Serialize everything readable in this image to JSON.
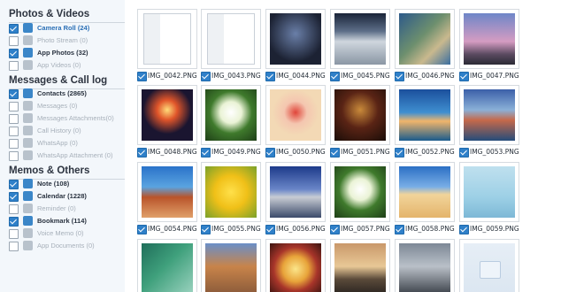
{
  "sidebar": {
    "sections": [
      {
        "title": "Photos & Videos",
        "items": [
          {
            "label": "Camera Roll (24)",
            "checked": true,
            "style": "sel",
            "icon": "camera-icon"
          },
          {
            "label": "Photo Stream (0)",
            "checked": false,
            "style": "off",
            "icon": "cloud-icon"
          },
          {
            "label": "App Photos (32)",
            "checked": true,
            "style": "bold",
            "icon": "app-photos-icon"
          },
          {
            "label": "App Videos (0)",
            "checked": false,
            "style": "off",
            "icon": "video-icon"
          }
        ]
      },
      {
        "title": "Messages & Call log",
        "items": [
          {
            "label": "Contacts (2865)",
            "checked": true,
            "style": "bold",
            "icon": "contacts-icon"
          },
          {
            "label": "Messages (0)",
            "checked": false,
            "style": "off",
            "icon": "message-icon"
          },
          {
            "label": "Messages Attachments(0)",
            "checked": false,
            "style": "off",
            "icon": "attachment-icon"
          },
          {
            "label": "Call History (0)",
            "checked": false,
            "style": "off",
            "icon": "phone-icon"
          },
          {
            "label": "WhatsApp (0)",
            "checked": false,
            "style": "off",
            "icon": "whatsapp-icon"
          },
          {
            "label": "WhatsApp Attachment (0)",
            "checked": false,
            "style": "off",
            "icon": "whatsapp-attachment-icon"
          }
        ]
      },
      {
        "title": "Memos & Others",
        "items": [
          {
            "label": "Note (108)",
            "checked": true,
            "style": "bold",
            "icon": "note-icon"
          },
          {
            "label": "Calendar (1228)",
            "checked": true,
            "style": "bold",
            "icon": "calendar-icon"
          },
          {
            "label": "Reminder (0)",
            "checked": false,
            "style": "off",
            "icon": "reminder-icon"
          },
          {
            "label": "Bookmark (114)",
            "checked": true,
            "style": "bold",
            "icon": "bookmark-icon"
          },
          {
            "label": "Voice Memo (0)",
            "checked": false,
            "style": "off",
            "icon": "microphone-icon"
          },
          {
            "label": "App Documents (0)",
            "checked": false,
            "style": "off",
            "icon": "document-icon"
          }
        ]
      }
    ]
  },
  "photos": [
    {
      "name": "IMG_0042.PNG",
      "checked": true,
      "thumb": "settings-screenshot"
    },
    {
      "name": "IMG_0043.PNG",
      "checked": true,
      "thumb": "settings-screenshot"
    },
    {
      "name": "IMG_0044.PNG",
      "checked": true,
      "thumb": "ipad-homescreen"
    },
    {
      "name": "IMG_0045.PNG",
      "checked": true,
      "thumb": "mountain-clouds"
    },
    {
      "name": "IMG_0046.PNG",
      "checked": true,
      "thumb": "coastline"
    },
    {
      "name": "IMG_0047.PNG",
      "checked": true,
      "thumb": "stonehenge"
    },
    {
      "name": "IMG_0048.PNG",
      "checked": true,
      "thumb": "fireworks"
    },
    {
      "name": "IMG_0049.PNG",
      "checked": true,
      "thumb": "white-rose"
    },
    {
      "name": "IMG_0050.PNG",
      "checked": true,
      "thumb": "cartoon-girl"
    },
    {
      "name": "IMG_0051.PNG",
      "checked": true,
      "thumb": "pirate-poster"
    },
    {
      "name": "IMG_0052.PNG",
      "checked": true,
      "thumb": "harbor-bridge"
    },
    {
      "name": "IMG_0053.PNG",
      "checked": true,
      "thumb": "mountain-lake"
    },
    {
      "name": "IMG_0054.PNG",
      "checked": true,
      "thumb": "desert-rock"
    },
    {
      "name": "IMG_0055.PNG",
      "checked": true,
      "thumb": "yellow-tulips"
    },
    {
      "name": "IMG_0056.PNG",
      "checked": true,
      "thumb": "museum-building"
    },
    {
      "name": "IMG_0057.PNG",
      "checked": true,
      "thumb": "white-rose"
    },
    {
      "name": "IMG_0058.PNG",
      "checked": true,
      "thumb": "beach-sand"
    },
    {
      "name": "IMG_0059.PNG",
      "checked": true,
      "thumb": "girl-umbrella"
    },
    {
      "name": "",
      "checked": false,
      "thumb": "green-canyon"
    },
    {
      "name": "",
      "checked": false,
      "thumb": "italian-houses"
    },
    {
      "name": "",
      "checked": false,
      "thumb": "cake"
    },
    {
      "name": "",
      "checked": false,
      "thumb": "pier-sunset"
    },
    {
      "name": "",
      "checked": false,
      "thumb": "winter-trees"
    },
    {
      "name": "",
      "checked": false,
      "thumb": "placeholder"
    }
  ],
  "colors": {
    "accent": "#2f80c9",
    "sidebar_bg": "#f3f7fb"
  }
}
